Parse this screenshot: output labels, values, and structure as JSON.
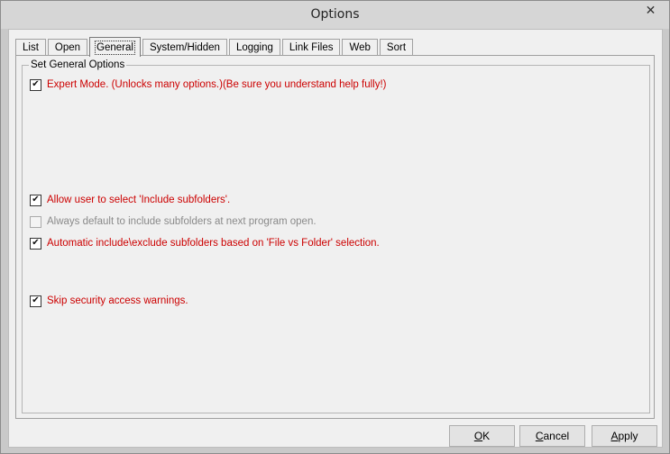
{
  "window": {
    "title": "Options",
    "close_glyph": "✕"
  },
  "tabs": [
    {
      "label": "List",
      "active": false
    },
    {
      "label": "Open",
      "active": false
    },
    {
      "label": "General",
      "active": true
    },
    {
      "label": "System/Hidden",
      "active": false
    },
    {
      "label": "Logging",
      "active": false
    },
    {
      "label": "Link Files",
      "active": false
    },
    {
      "label": "Web",
      "active": false
    },
    {
      "label": "Sort",
      "active": false
    }
  ],
  "group": {
    "label": "Set General Options",
    "options": [
      {
        "label": "Expert Mode.  (Unlocks many options.)(Be sure you understand help fully!)",
        "checked": true,
        "enabled": true
      },
      {
        "label": "Allow user to select  'Include subfolders'.",
        "checked": true,
        "enabled": true
      },
      {
        "label": "Always default to include subfolders at next program open.",
        "checked": false,
        "enabled": false
      },
      {
        "label": "Automatic include\\exclude subfolders based on 'File vs Folder' selection.",
        "checked": true,
        "enabled": true
      },
      {
        "label": "Skip security access warnings.",
        "checked": true,
        "enabled": true
      }
    ]
  },
  "buttons": {
    "ok": {
      "mnemonic": "O",
      "rest": "K"
    },
    "cancel": {
      "mnemonic": "C",
      "rest": "ancel"
    },
    "apply": {
      "mnemonic": "A",
      "rest": "pply"
    }
  },
  "colors": {
    "accent_text": "#cc0000",
    "disabled_text": "#8a8a8a"
  },
  "icons": {
    "check": "check-icon",
    "close": "close-icon"
  }
}
